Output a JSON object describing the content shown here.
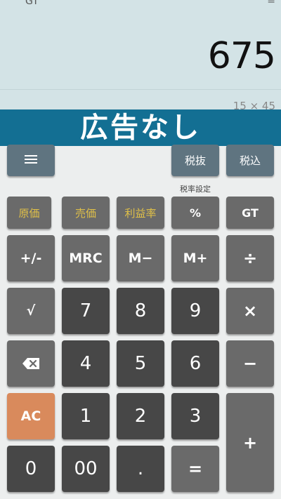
{
  "display": {
    "gt_indicator": "GT",
    "equals_indicator": "=",
    "result": "675",
    "expression": "15 × 45"
  },
  "banner": {
    "text": "広告なし"
  },
  "top_row": {
    "menu_icon": "menu-icon",
    "tax_exclusive": "税抜",
    "tax_inclusive": "税込",
    "tax_settings": "税率設定"
  },
  "keys": {
    "cost": "原価",
    "selling_price": "売価",
    "profit_margin": "利益率",
    "percent": "%",
    "gt": "GT",
    "sign": "+/-",
    "mrc": "MRC",
    "m_minus": "M−",
    "m_plus": "M+",
    "divide": "÷",
    "sqrt": "√",
    "seven": "7",
    "eight": "8",
    "nine": "9",
    "multiply": "×",
    "backspace_icon": "backspace-icon",
    "four": "4",
    "five": "5",
    "six": "6",
    "minus": "−",
    "ac": "AC",
    "one": "1",
    "two": "2",
    "three": "3",
    "plus": "+",
    "zero": "0",
    "double_zero": "00",
    "decimal": ".",
    "equals": "="
  },
  "colors": {
    "display_bg": "#d3e3e6",
    "banner_bg": "#136f93",
    "top_key": "#5f7480",
    "function_key": "#6a6a6a",
    "number_key": "#474747",
    "ac_key": "#d98a5c",
    "margin_text": "#e0c048"
  }
}
